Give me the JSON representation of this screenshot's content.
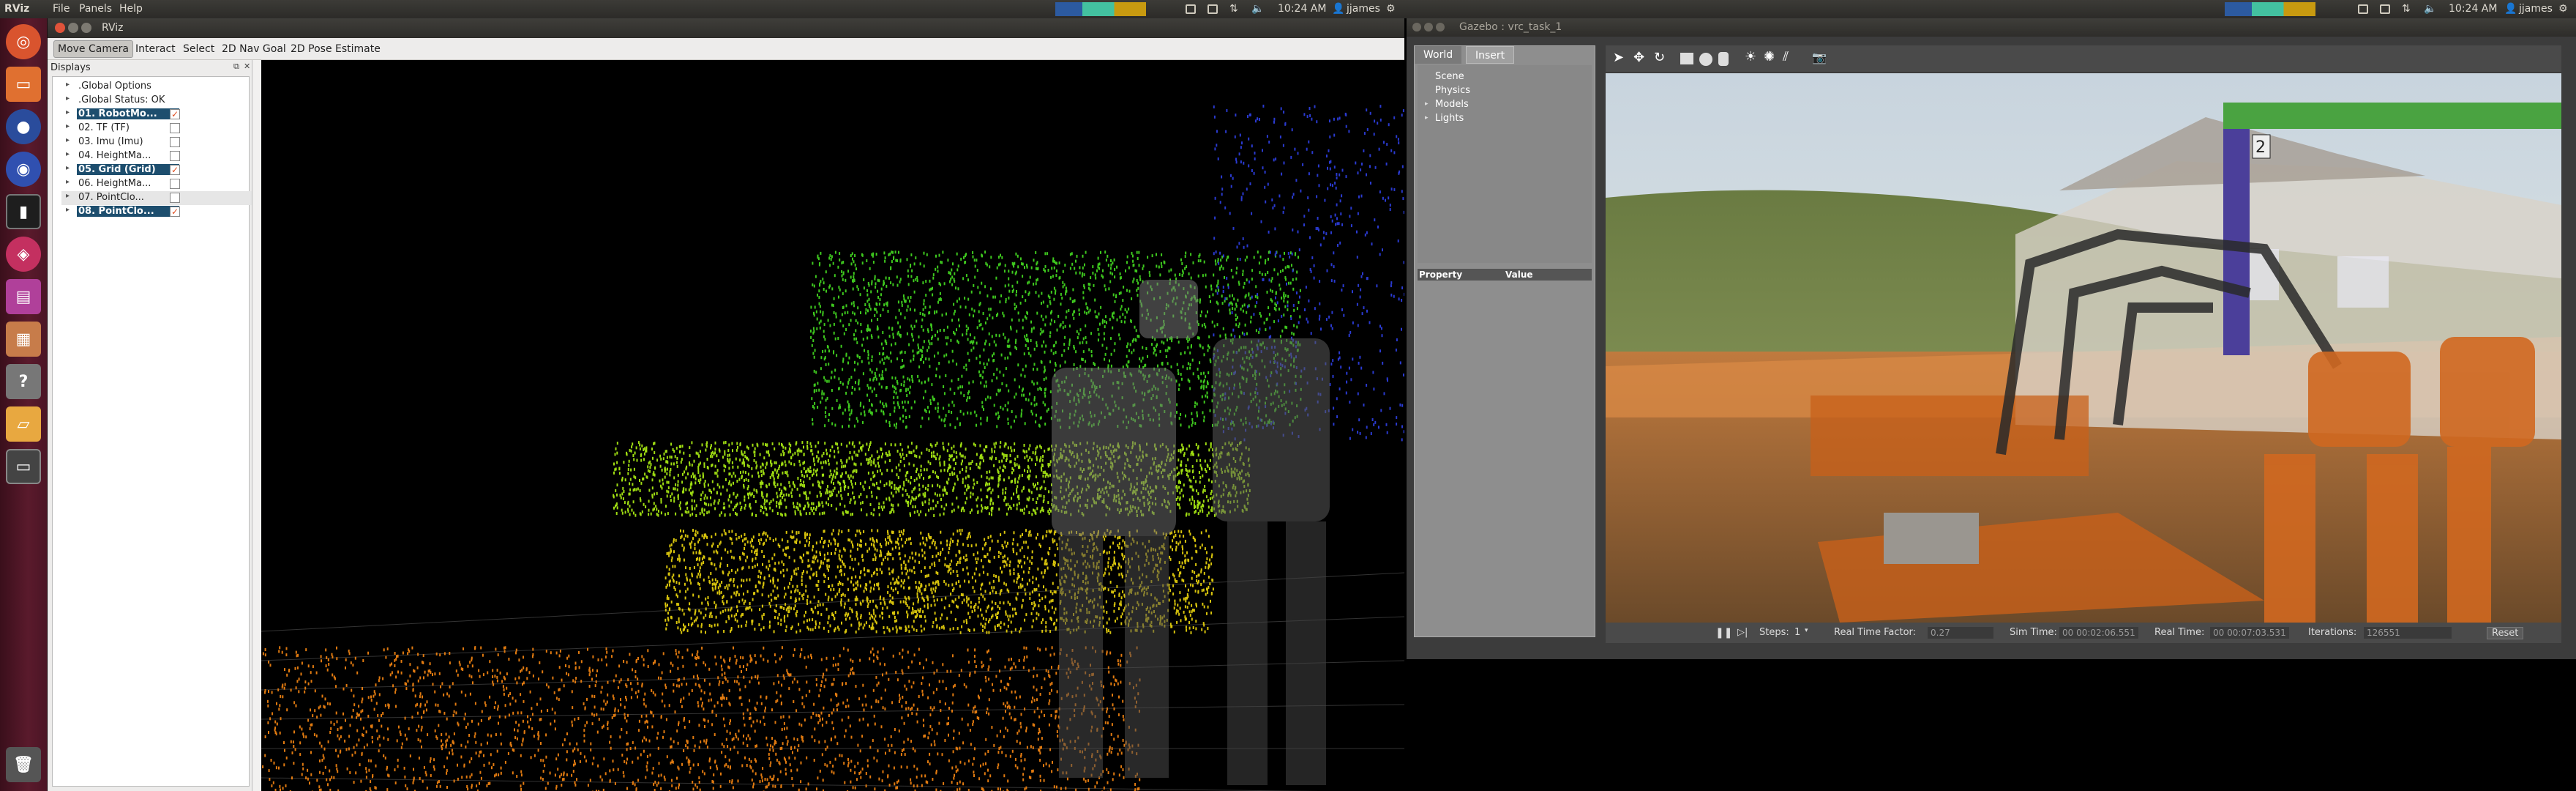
{
  "topbar": {
    "app_name": "RViz",
    "menus": [
      "File",
      "Panels",
      "Help"
    ],
    "clock_left": "10:24 AM",
    "user_left": "jjames",
    "clock_right": "10:24 AM",
    "user_right": "jjames"
  },
  "rviz": {
    "window_title": "RViz",
    "tools": [
      "Move Camera",
      "Interact",
      "Select",
      "2D Nav Goal",
      "2D Pose Estimate"
    ],
    "displays_title": "Displays",
    "displays": [
      {
        "label": ".Global Options",
        "checked": null,
        "selected": false
      },
      {
        "label": ".Global Status: OK",
        "checked": null,
        "selected": false
      },
      {
        "label": "01. RobotMo...",
        "checked": true,
        "selected": true
      },
      {
        "label": "02. TF (TF)",
        "checked": false,
        "selected": false
      },
      {
        "label": "03. Imu (Imu)",
        "checked": false,
        "selected": false
      },
      {
        "label": "04. HeightMa...",
        "checked": false,
        "selected": false
      },
      {
        "label": "05. Grid (Grid)",
        "checked": true,
        "selected": true
      },
      {
        "label": "06. HeightMa...",
        "checked": false,
        "selected": false
      },
      {
        "label": "07. PointClo...",
        "checked": false,
        "selected": false
      },
      {
        "label": "08. PointClo...",
        "checked": true,
        "selected": true
      }
    ]
  },
  "gazebo": {
    "window_title": "Gazebo : vrc_task_1",
    "tabs": [
      "World",
      "Insert"
    ],
    "tree": [
      "Scene",
      "Physics",
      "Models",
      "Lights"
    ],
    "prop_headers": [
      "Property",
      "Value"
    ],
    "status": {
      "steps_label": "Steps:",
      "steps_value": "1",
      "rtf_label": "Real Time Factor:",
      "rtf_value": "0.27",
      "sim_label": "Sim Time:",
      "sim_value": "00 00:02:06.551",
      "real_label": "Real Time:",
      "real_value": "00 00:07:03.531",
      "iter_label": "Iterations:",
      "iter_value": "126551",
      "reset_label": "Reset"
    },
    "sign_number": "2"
  },
  "colors": {
    "launcher": "#5a1a2c",
    "selected": "#1d4e6e",
    "accent": "#e24d1f"
  }
}
